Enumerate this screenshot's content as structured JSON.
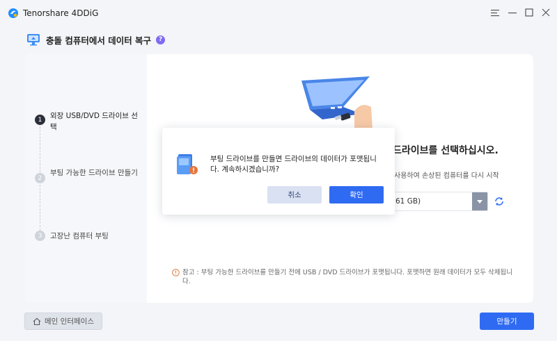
{
  "app": {
    "title": "Tenorshare 4DDiG",
    "window_controls": [
      "menu-icon",
      "minimize-icon",
      "maximize-icon",
      "close-icon"
    ]
  },
  "page": {
    "title": "충돌 컴퓨터에서 데이터 복구",
    "help": "?"
  },
  "steps": [
    {
      "num": "1",
      "label": "외장 USB/DVD 드라이브 선택",
      "active": true
    },
    {
      "num": "2",
      "label": "부팅 가능한 드라이브 만들기",
      "active": false
    },
    {
      "num": "3",
      "label": "고장난 컴퓨터 부팅",
      "active": false
    }
  ],
  "content": {
    "heading_partial": "드라이브를 선택하십시오.",
    "desc_partial": "사용하여 손상된 컴퓨터를 다시 시작",
    "drive_select_value": "61 GB)",
    "notice": "참고 : 부팅 가능한 드라이브를 만들기 전에 USB / DVD 드라이브가 포맷됩니다. 포맷하면 원래 데이터가 모두 삭제됩니다."
  },
  "footer": {
    "main_interface": "메인 인터페이스",
    "create": "만들기"
  },
  "dialog": {
    "message": "부팅 드라이브를 만들면 드라이브의 데이터가 포맷됩니다. 계속하시겠습니까?",
    "cancel": "취소",
    "ok": "확인"
  },
  "colors": {
    "accent": "#2f6bf2",
    "help_badge": "#7d6cf2",
    "warning": "#e07b39"
  }
}
